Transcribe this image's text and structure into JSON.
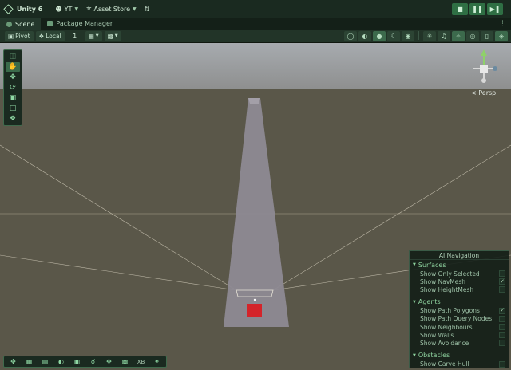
{
  "topbar": {
    "app_name": "Unity 6",
    "account": "YT",
    "store": "Asset Store",
    "icons": [
      "unity-logo-icon",
      "account-icon",
      "cart-icon",
      "version-control-icon",
      "play-icon",
      "pause-icon",
      "step-icon"
    ]
  },
  "tabs": [
    {
      "label": "Scene",
      "active": true
    },
    {
      "label": "Package Manager",
      "active": false
    }
  ],
  "scenebar": {
    "pivot_label": "Pivot",
    "local_label": "Local",
    "grid_value": "1"
  },
  "viewport": {
    "projection_label": "< Persp",
    "sky_color": "#9fa3a6",
    "ground_color": "#5a5749",
    "cube_color": "#d4242a"
  },
  "ai_navigation": {
    "title": "AI Navigation",
    "sections": [
      {
        "label": "Surfaces",
        "items": [
          {
            "label": "Show Only Selected",
            "checked": false
          },
          {
            "label": "Show NavMesh",
            "checked": true
          },
          {
            "label": "Show HeightMesh",
            "checked": false
          }
        ]
      },
      {
        "label": "Agents",
        "items": [
          {
            "label": "Show Path Polygons",
            "checked": true
          },
          {
            "label": "Show Path Query Nodes",
            "checked": false
          },
          {
            "label": "Show Neighbours",
            "checked": false
          },
          {
            "label": "Show Walls",
            "checked": false
          },
          {
            "label": "Show Avoidance",
            "checked": false
          }
        ]
      },
      {
        "label": "Obstacles",
        "items": [
          {
            "label": "Show Carve Hull",
            "checked": false
          }
        ]
      }
    ]
  },
  "bottombar": {
    "xb_label": "XB"
  },
  "accent_color": "#3fa862"
}
